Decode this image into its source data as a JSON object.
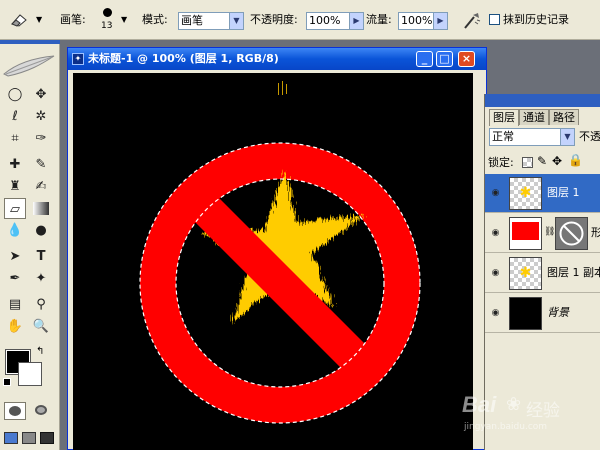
{
  "options_bar": {
    "brush_label": "画笔:",
    "brush_size": "13",
    "mode_label": "模式:",
    "mode_value": "画笔",
    "opacity_label": "不透明度:",
    "opacity_value": "100%",
    "flow_label": "流量:",
    "flow_value": "100%",
    "history_label": "抹到历史记录"
  },
  "document": {
    "title": "未标题-1 @ 100% (图层 1, RGB/8)",
    "minimize_glyph": "_",
    "maximize_glyph": "□",
    "close_glyph": "×",
    "colors": {
      "sign_red": "#ff0000",
      "star_yellow": "#ffcc00",
      "canvas_bg": "#000000"
    }
  },
  "layers_panel": {
    "tabs": [
      "图层",
      "通道",
      "路径"
    ],
    "blend_mode": "正常",
    "opacity_label": "不透",
    "lock_label": "锁定:",
    "layers": [
      {
        "name": "图层 1",
        "selected": true
      },
      {
        "name": "形",
        "selected": false
      },
      {
        "name": "图层 1 副本",
        "selected": false
      },
      {
        "name": "背景",
        "selected": false
      }
    ]
  },
  "watermark": {
    "brand": "Bai",
    "brand2": "经验",
    "url": "jingyan.baidu.com"
  }
}
